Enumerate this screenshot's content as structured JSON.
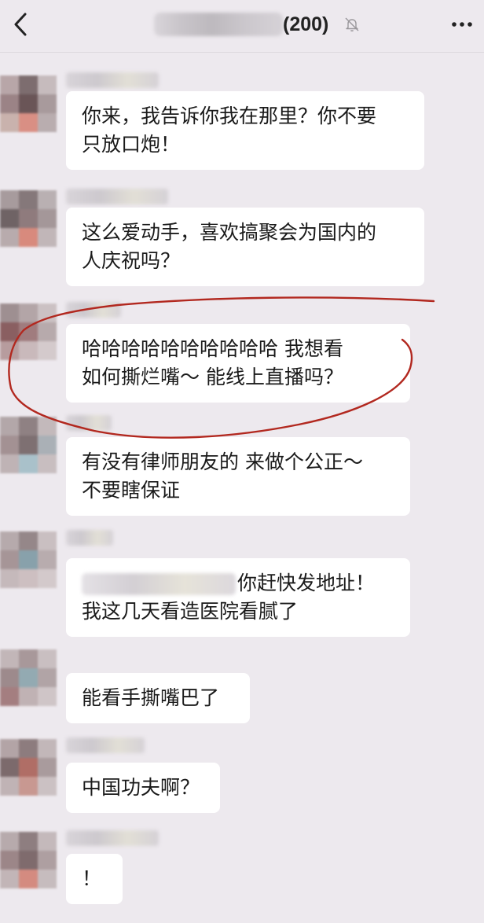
{
  "header": {
    "member_count": "(200)",
    "icons": {
      "back": "back-arrow-icon",
      "mute": "muted-bell-icon",
      "more": "more-icon"
    }
  },
  "messages": [
    {
      "lines": [
        "你来，我告诉你我在那里？你不要",
        "只放口炮！"
      ]
    },
    {
      "lines": [
        "这么爱动手，喜欢搞聚会为国内的",
        "人庆祝吗？"
      ]
    },
    {
      "lines": [
        "哈哈哈哈哈哈哈哈哈哈 我想看",
        "如何撕烂嘴～ 能线上直播吗？"
      ]
    },
    {
      "lines": [
        "有没有律师朋友的 来做个公正～",
        "不要瞎保证"
      ]
    },
    {
      "lines": [
        "你赶快发地址！",
        "我这几天看造医院看腻了"
      ]
    },
    {
      "lines": [
        "能看手撕嘴巴了"
      ]
    },
    {
      "lines": [
        "中国功夫啊？"
      ]
    },
    {
      "lines": [
        "！"
      ]
    }
  ],
  "colors": {
    "background": "#ede9ee",
    "bubble": "#ffffff",
    "annotation": "#b2281f"
  }
}
